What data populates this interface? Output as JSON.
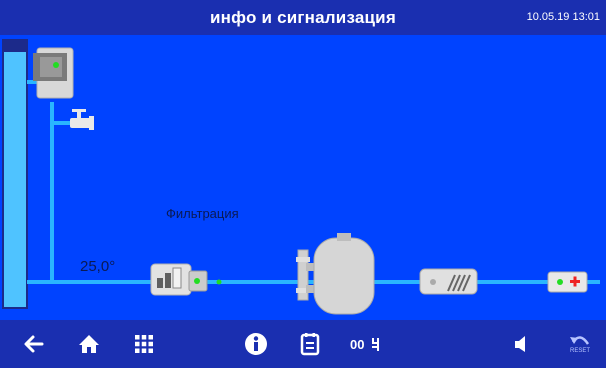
{
  "header": {
    "title": "инфо и сигнализация",
    "datetime": "10.05.19 13:01"
  },
  "scheme": {
    "filtration_label": "Фильтрация",
    "temperature_label": "25,0°"
  },
  "toolbar": {
    "buttons": [
      {
        "name": "back-button",
        "icon": "arrow-left-icon"
      },
      {
        "name": "home-button",
        "icon": "home-icon"
      },
      {
        "name": "menu-button",
        "icon": "grid-icon"
      },
      {
        "name": "info-button",
        "icon": "info-icon"
      },
      {
        "name": "log-button",
        "icon": "notepad-icon"
      },
      {
        "name": "counter-button",
        "icon": "counter-icon"
      },
      {
        "name": "sound-button",
        "icon": "speaker-icon"
      },
      {
        "name": "reset-button",
        "icon": "reset-icon"
      }
    ],
    "reset_label": "RESET",
    "counter_label": "00"
  },
  "colors": {
    "background": "#0043ff",
    "bar": "#1a2fb0",
    "pipe": "#29b6ff",
    "indicator_green": "#22dd22",
    "indicator_red": "#ee2222"
  }
}
